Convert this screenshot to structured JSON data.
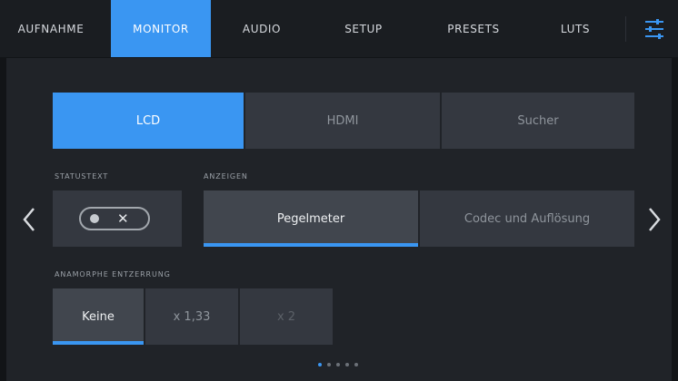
{
  "tabs": [
    {
      "label": "AUFNAHME",
      "active": false
    },
    {
      "label": "MONITOR",
      "active": true
    },
    {
      "label": "AUDIO",
      "active": false
    },
    {
      "label": "SETUP",
      "active": false
    },
    {
      "label": "PRESETS",
      "active": false
    },
    {
      "label": "LUTS",
      "active": false
    }
  ],
  "settings_icon": "sliders-icon",
  "outputs": [
    {
      "label": "LCD",
      "active": true
    },
    {
      "label": "HDMI",
      "active": false
    },
    {
      "label": "Sucher",
      "active": false
    }
  ],
  "status_text": {
    "label": "STATUSTEXT",
    "toggle_symbol": "✕",
    "enabled": false
  },
  "display": {
    "label": "ANZEIGEN",
    "options": [
      {
        "label": "Pegelmeter",
        "selected": true
      },
      {
        "label": "Codec und Auflösung",
        "selected": false
      }
    ]
  },
  "anamorphic": {
    "label": "ANAMORPHE ENTZERRUNG",
    "options": [
      {
        "label": "Keine",
        "selected": true
      },
      {
        "label": "x 1,33",
        "selected": false
      },
      {
        "label": "x 2",
        "selected": false
      }
    ]
  },
  "pagination": {
    "pages": 5,
    "current": 1
  },
  "colors": {
    "accent": "#3a96f2",
    "background": "#121417",
    "panel": "#202328",
    "button": "#343840"
  }
}
